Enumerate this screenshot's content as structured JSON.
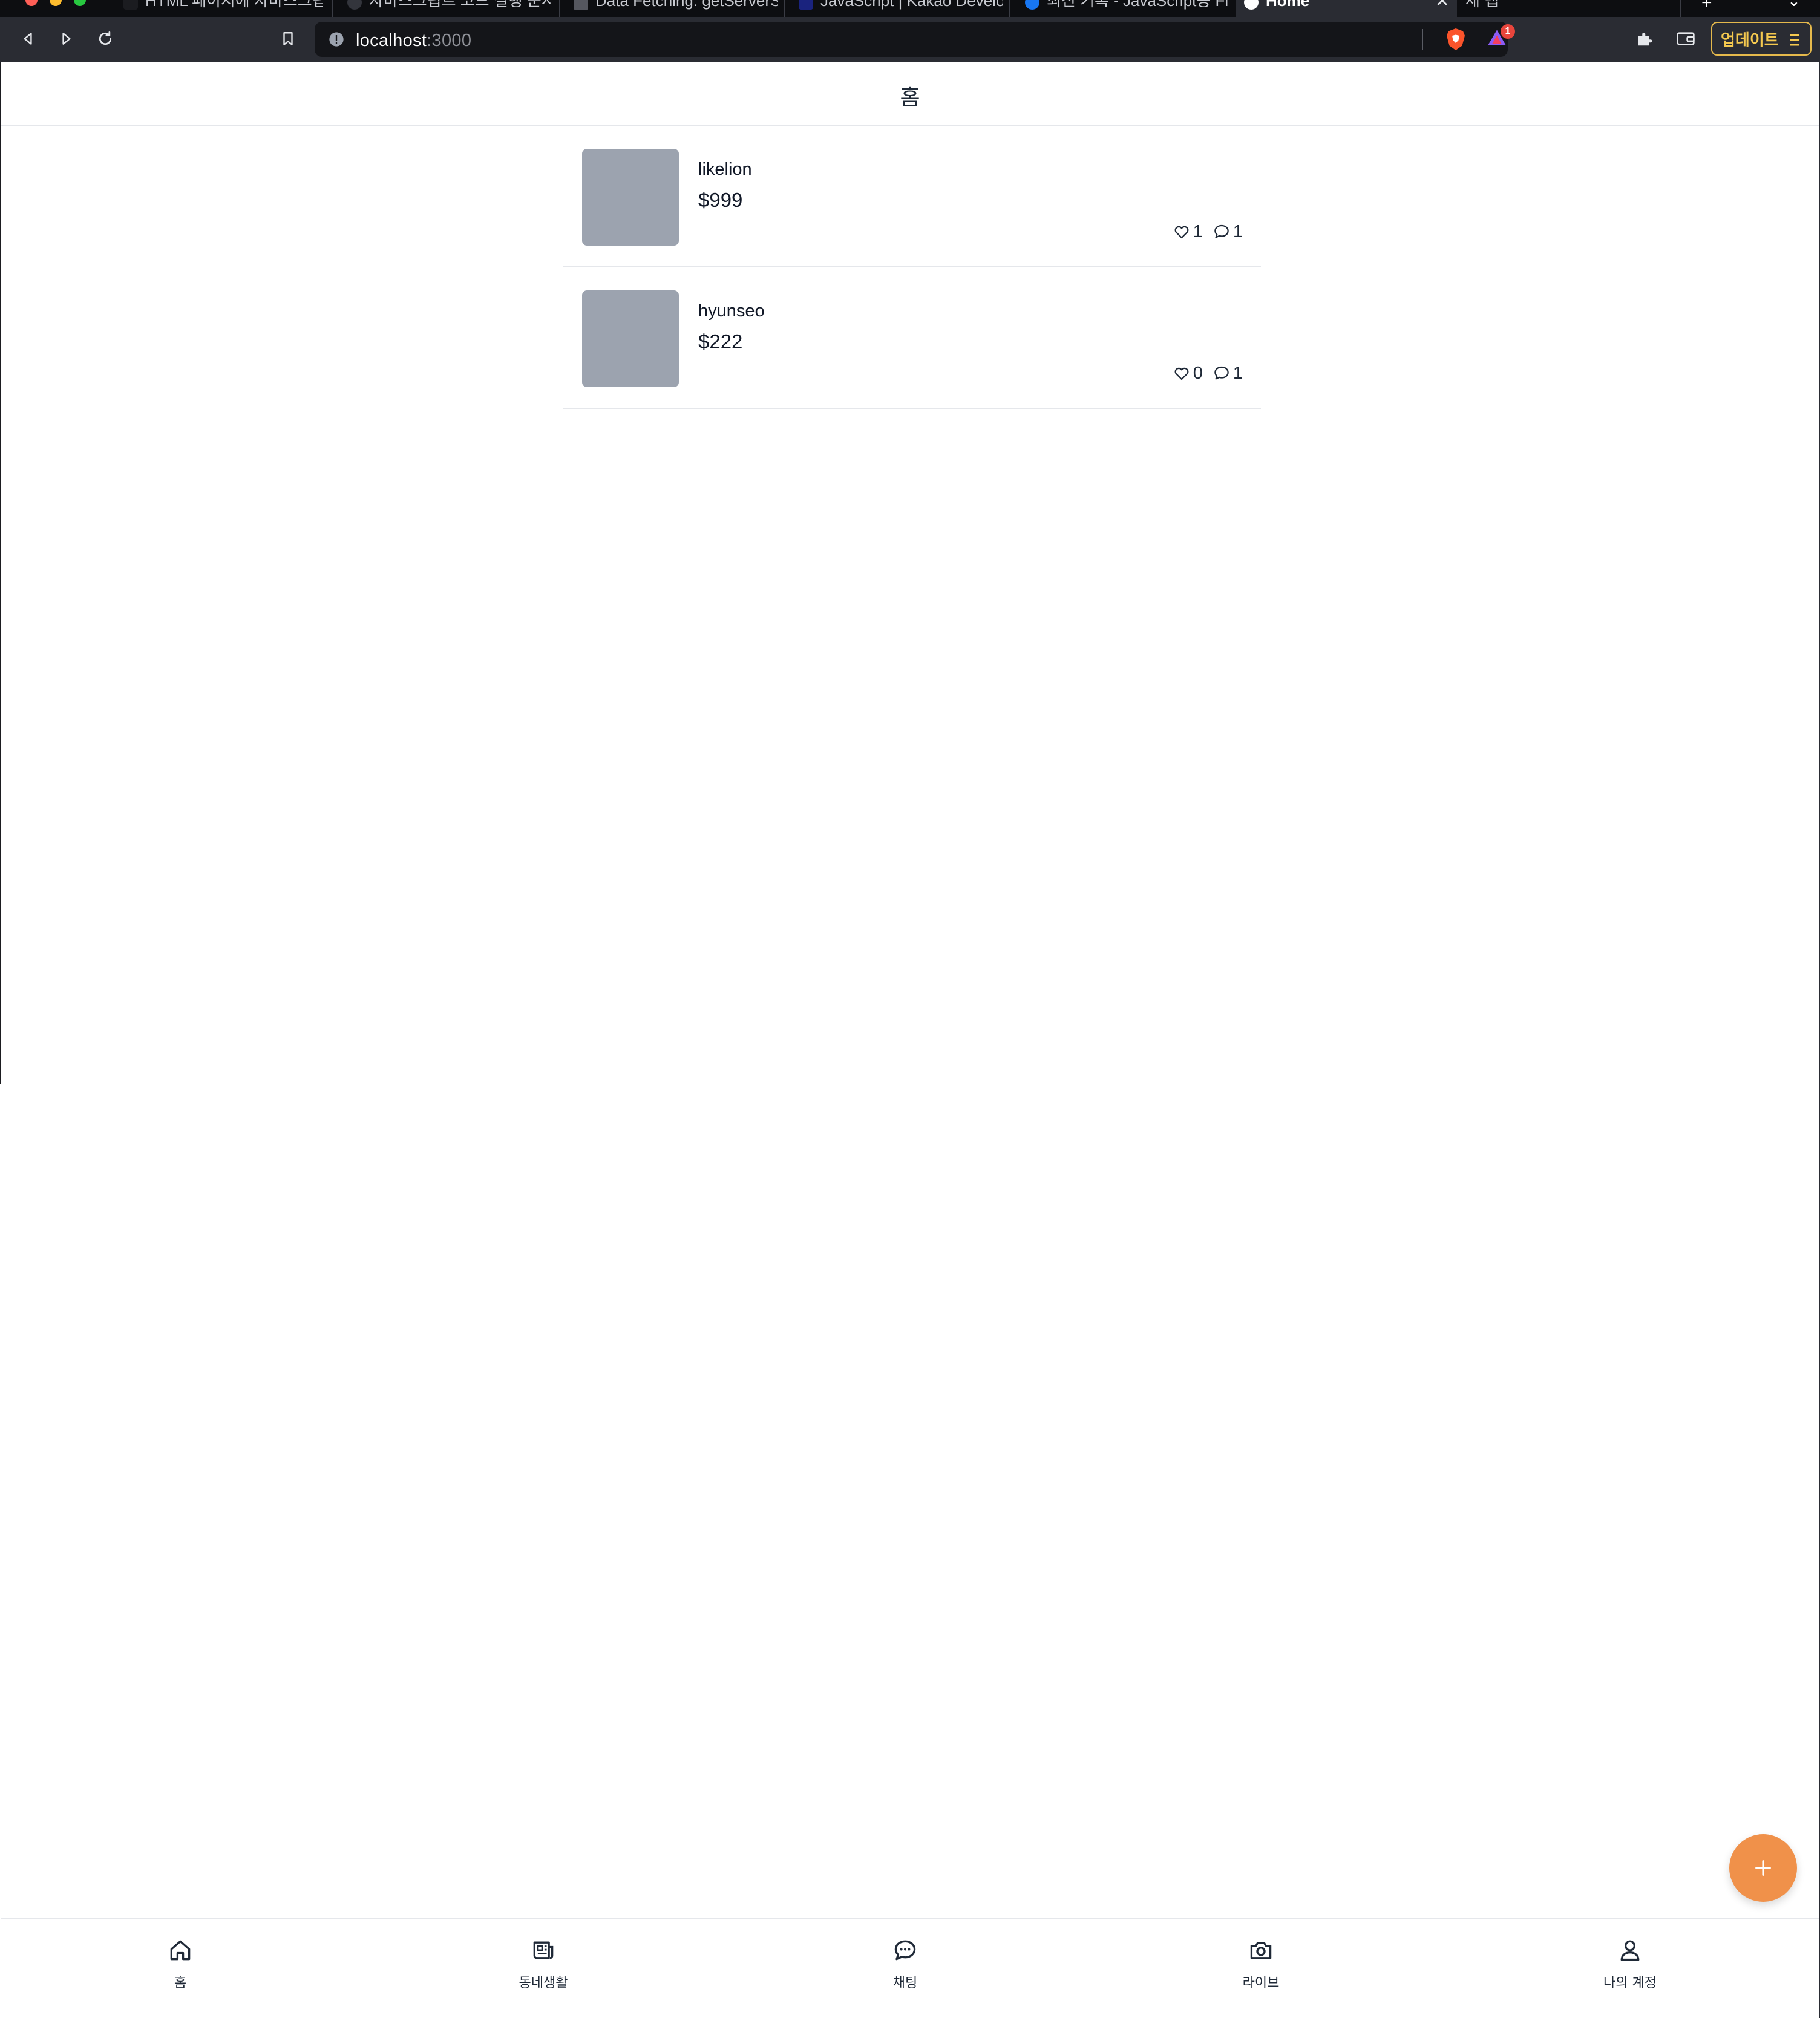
{
  "browser": {
    "tabs": [
      {
        "title": "HTML 페이지에 자바스크립트"
      },
      {
        "title": "자바스크립트 코드 실행 순서 - "
      },
      {
        "title": "Data Fetching: getServerS"
      },
      {
        "title": "JavaScript | Kakao Develo"
      },
      {
        "title": "최신 기록 - JavaScript용 Fir"
      },
      {
        "title": "Home"
      },
      {
        "title": "새 탭"
      }
    ],
    "url_host": "localhost",
    "url_port": ":3000",
    "rewards_badge": "1",
    "update_label": "업데이트"
  },
  "header": {
    "title": "홈"
  },
  "products": [
    {
      "name": "likelion",
      "price": "$999",
      "likes": "1",
      "comments": "1"
    },
    {
      "name": "hyunseo",
      "price": "$222",
      "likes": "0",
      "comments": "1"
    }
  ],
  "nav": {
    "items": [
      {
        "label": "홈",
        "icon": "home-icon"
      },
      {
        "label": "동네생활",
        "icon": "newspaper-icon"
      },
      {
        "label": "채팅",
        "icon": "chat-icon"
      },
      {
        "label": "라이브",
        "icon": "camera-icon"
      },
      {
        "label": "나의 계정",
        "icon": "user-icon"
      }
    ]
  },
  "colors": {
    "fab": "#f0914a",
    "thumbnail": "#9ca3af",
    "update_button": "#f5c94f",
    "browser_toolbar": "#2a2c33"
  }
}
